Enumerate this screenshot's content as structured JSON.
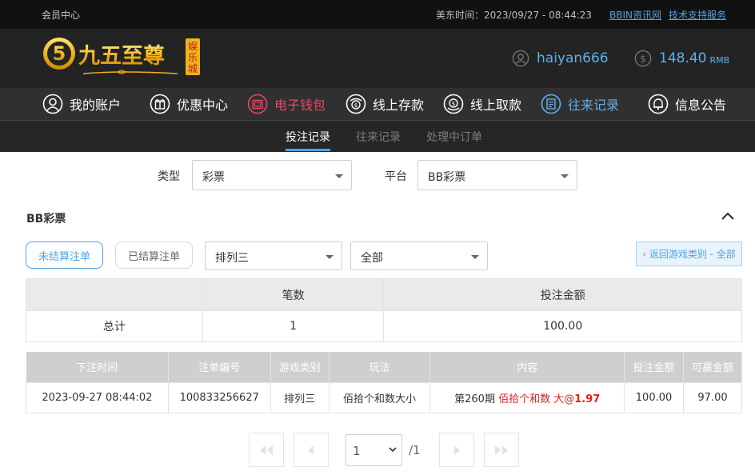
{
  "topbar": {
    "member_center": "会员中心",
    "time_label": "美东时间：2023/09/27 - 08:44:23",
    "link_bbin": "BBIN资讯网",
    "link_support": "技术支持服务"
  },
  "header": {
    "logo_text": "九五至尊",
    "logo_badge": "娱乐城",
    "username": "haiyan666",
    "balance": "148.40",
    "currency": "RMB"
  },
  "nav": {
    "items": [
      {
        "label": "我的账户",
        "icon": "user-icon"
      },
      {
        "label": "优惠中心",
        "icon": "gift-icon"
      },
      {
        "label": "电子钱包",
        "icon": "wallet-icon"
      },
      {
        "label": "线上存款",
        "icon": "deposit-icon"
      },
      {
        "label": "线上取款",
        "icon": "withdraw-icon"
      },
      {
        "label": "往来记录",
        "icon": "records-icon"
      },
      {
        "label": "信息公告",
        "icon": "bell-icon"
      }
    ],
    "active_colors": {
      "wallet": "#e8465e",
      "records": "#5fb0ee"
    }
  },
  "subnav": {
    "tabs": [
      "投注记录",
      "往来记录",
      "处理中订单"
    ],
    "active": "投注记录"
  },
  "filters": {
    "type_label": "类型",
    "type_value": "彩票",
    "platform_label": "平台",
    "platform_value": "BB彩票"
  },
  "section": {
    "title": "BB彩票",
    "btn_unsettled": "未结算注单",
    "btn_settled": "已结算注单",
    "game_select": "排列三",
    "scope_select": "全部",
    "back_button": "‹ 返回游戏类别 - 全部"
  },
  "summary": {
    "headers": [
      "",
      "笔数",
      "投注金额"
    ],
    "row": [
      "总计",
      "1",
      "100.00"
    ]
  },
  "detail": {
    "headers": [
      "下注时间",
      "注单编号",
      "游戏类别",
      "玩法",
      "内容",
      "投注金额",
      "可赢金额"
    ],
    "rows": [
      {
        "time": "2023-09-27 08:44:02",
        "order_no": "100833256627",
        "game": "排列三",
        "play": "佰拾个和数大小",
        "content_period": "第260期",
        "content_bet": "佰拾个和数 大",
        "content_at": "@",
        "content_odds": "1.97",
        "bet_amount": "100.00",
        "win_amount": "97.00"
      }
    ]
  },
  "pagination": {
    "current": "1",
    "total": "/1"
  },
  "colors": {
    "accent": "#4fa3e6",
    "wallet_red": "#e8465e",
    "odds_red": "#e01e1e",
    "header_dark": "#232323"
  }
}
